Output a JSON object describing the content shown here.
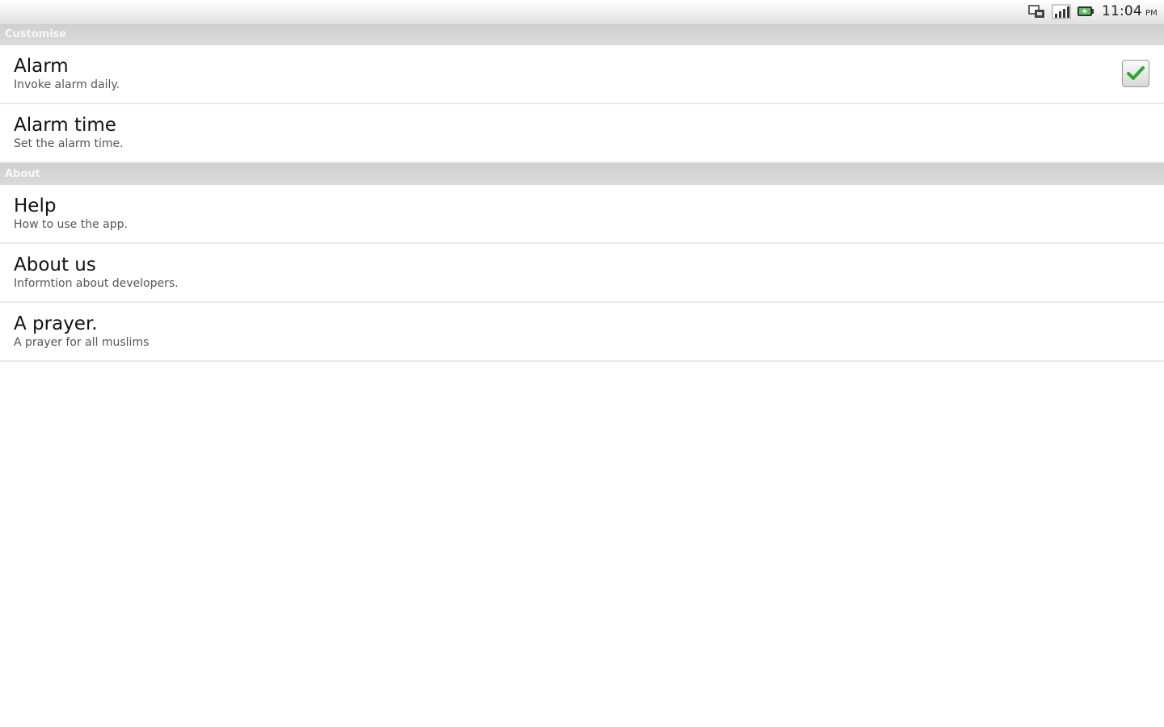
{
  "status_bar": {
    "time": "11:04",
    "ampm": "PM",
    "icons": [
      "usb-debug-icon",
      "signal-bars-icon",
      "battery-icon"
    ]
  },
  "sections": [
    {
      "title": "Customise",
      "items": [
        {
          "title": "Alarm",
          "summary": "Invoke alarm daily.",
          "checked": true
        },
        {
          "title": "Alarm time",
          "summary": "Set the alarm time."
        }
      ]
    },
    {
      "title": "About",
      "items": [
        {
          "title": "Help",
          "summary": "How to use the app."
        },
        {
          "title": "About us",
          "summary": "Informtion about developers."
        },
        {
          "title": "A prayer.",
          "summary": "A prayer for all muslims"
        }
      ]
    }
  ],
  "colors": {
    "check_green": "#2fa82f",
    "category_bg": "#d4d4d4",
    "divider": "#e8e8e8"
  }
}
